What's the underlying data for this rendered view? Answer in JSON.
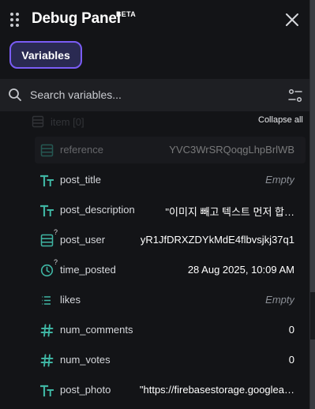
{
  "header": {
    "title": "Debug Panel",
    "badge": "BETA"
  },
  "tabs": [
    {
      "label": "Variables",
      "active": true
    }
  ],
  "search": {
    "placeholder": "Search variables..."
  },
  "list": {
    "parent_label": "item [0]",
    "collapse_label": "Collapse all",
    "rows": [
      {
        "name": "reference",
        "value": "YVC3WrSRQoqgLhpBrlWB",
        "icon": "document-reference-icon",
        "empty": false,
        "nullable": false,
        "dimmed": true
      },
      {
        "name": "post_title",
        "value": "Empty",
        "icon": "text-type-icon",
        "empty": true,
        "nullable": false,
        "dimmed": false
      },
      {
        "name": "post_description",
        "value": "\"이미지 빼고 텍스트 먼저 합…",
        "icon": "text-type-icon",
        "empty": false,
        "nullable": false,
        "dimmed": false
      },
      {
        "name": "post_user",
        "value": "yR1JfDRXZDYkMdE4flbvsjkj37q1",
        "icon": "document-reference-icon",
        "empty": false,
        "nullable": true,
        "dimmed": false
      },
      {
        "name": "time_posted",
        "value": "28 Aug 2025, 10:09 AM",
        "icon": "clock-icon",
        "empty": false,
        "nullable": true,
        "dimmed": false
      },
      {
        "name": "likes",
        "value": "Empty",
        "icon": "list-icon",
        "empty": true,
        "nullable": false,
        "dimmed": false
      },
      {
        "name": "num_comments",
        "value": "0",
        "icon": "hash-icon",
        "empty": false,
        "nullable": false,
        "dimmed": false
      },
      {
        "name": "num_votes",
        "value": "0",
        "icon": "hash-icon",
        "empty": false,
        "nullable": false,
        "dimmed": false
      },
      {
        "name": "post_photo",
        "value": "\"https://firebasestorage.googlea…",
        "icon": "text-type-icon",
        "empty": false,
        "nullable": false,
        "dimmed": false
      }
    ]
  },
  "colors": {
    "panel_bg": "#131417",
    "accent": "#7a5cf5",
    "icon_teal": "#3fb5a3"
  }
}
